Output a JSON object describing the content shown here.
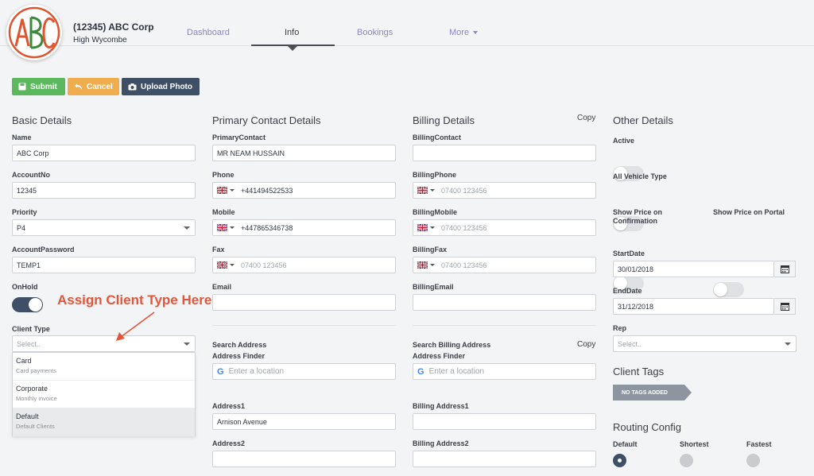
{
  "org": {
    "name": "(12345) ABC Corp",
    "city": "High Wycombe",
    "logo_text": "ABC"
  },
  "nav": {
    "tabs": [
      "Dashboard",
      "Info",
      "Bookings",
      "More"
    ],
    "active": "Info"
  },
  "toolbar": {
    "submit": "Submit",
    "cancel": "Cancel",
    "upload": "Upload Photo"
  },
  "basic": {
    "title": "Basic Details",
    "name_label": "Name",
    "name_value": "ABC Corp",
    "accountno_label": "AccountNo",
    "accountno_value": "12345",
    "priority_label": "Priority",
    "priority_value": "P4",
    "password_label": "AccountPassword",
    "password_value": "TEMP1",
    "onhold_label": "OnHold",
    "clienttype_label": "Client Type",
    "clienttype_placeholder": "Select..",
    "clienttype_options": [
      {
        "title": "Card",
        "sub": "Card payments"
      },
      {
        "title": "Corporate",
        "sub": "Monthly invoice"
      },
      {
        "title": "Default",
        "sub": "Default Clients"
      }
    ]
  },
  "annotation": "Assign Client Type Here",
  "contact": {
    "title": "Primary Contact Details",
    "primary_label": "PrimaryContact",
    "primary_value": "MR NEAM HUSSAIN",
    "phone_label": "Phone",
    "phone_value": "+441494522533",
    "mobile_label": "Mobile",
    "mobile_value": "+447865346738",
    "fax_label": "Fax",
    "fax_placeholder": "07400 123456",
    "email_label": "Email",
    "search_label": "Search Address",
    "finder_label": "Address Finder",
    "finder_placeholder": "Enter a location",
    "address1_label": "Address1",
    "address1_value": "Arnison Avenue",
    "address2_label": "Address2"
  },
  "billing": {
    "title": "Billing Details",
    "copy": "Copy",
    "contact_label": "BillingContact",
    "phone_label": "BillingPhone",
    "phone_placeholder": "07400 123456",
    "mobile_label": "BillingMobile",
    "mobile_placeholder": "07400 123456",
    "fax_label": "BillingFax",
    "fax_placeholder": "07400 123456",
    "email_label": "BillingEmail",
    "search_label": "Search Billing Address",
    "copy2": "Copy",
    "finder_label": "Address Finder",
    "finder_placeholder": "Enter a location",
    "address1_label": "Billing Address1",
    "address2_label": "Billing Address2"
  },
  "other": {
    "title": "Other Details",
    "active_label": "Active",
    "vehicle_label": "All Vehicle Type",
    "showprice_label": "Show Price on Confirmation",
    "showportal_label": "Show Price on Portal",
    "startdate_label": "StartDate",
    "startdate_value": "30/01/2018",
    "enddate_label": "EndDate",
    "enddate_value": "31/12/2018",
    "rep_label": "Rep",
    "rep_placeholder": "Select..",
    "tags_title": "Client Tags",
    "tags_empty": "NO TAGS ADDED",
    "routing_title": "Routing Config",
    "routing_options": [
      "Default",
      "Shortest",
      "Fastest"
    ],
    "routing_selected": "Default"
  },
  "colors": {
    "submit": "#5cb85c",
    "cancel": "#f0ad4e",
    "upload": "#3e4f66",
    "accent": "#3e4f66",
    "annotation": "#e5553a"
  }
}
